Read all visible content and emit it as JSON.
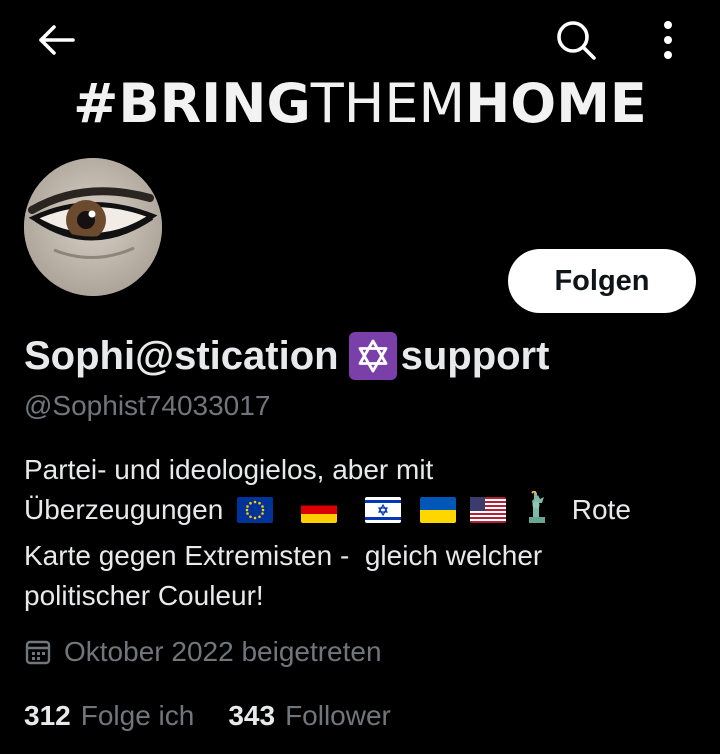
{
  "banner": {
    "part1": "#BRING",
    "part2": "THEM",
    "part3": "HOME"
  },
  "nav": {
    "back_icon": "arrow-left-icon",
    "search_icon": "search-icon",
    "more_icon": "more-vertical-icon"
  },
  "profile": {
    "name_part1": "Sophi@stication",
    "name_emoji": "star-of-david",
    "name_part2": "support",
    "handle": "@Sophist74033017",
    "follow_label": "Folgen",
    "bio": {
      "line1": "Partei- und ideologielos, aber mit",
      "line2_text": "Überzeugungen",
      "line2_flags": [
        "eu",
        "de",
        "il",
        "ua",
        "us",
        "statue-of-liberty"
      ],
      "line2_end": "Rote",
      "line3": "Karte gegen Extremisten -  gleich welcher",
      "line4": "politischer Couleur!"
    },
    "joined": "Oktober 2022 beigetreten",
    "following_count": "312",
    "following_label": "Folge ich",
    "followers_count": "343",
    "followers_label": "Follower"
  },
  "colors": {
    "background": "#000000",
    "text": "#e7e9ea",
    "secondary": "#71767b",
    "button_bg": "#ffffff",
    "button_text": "#0f1419",
    "emoji_purple": "#7a3fa8"
  }
}
